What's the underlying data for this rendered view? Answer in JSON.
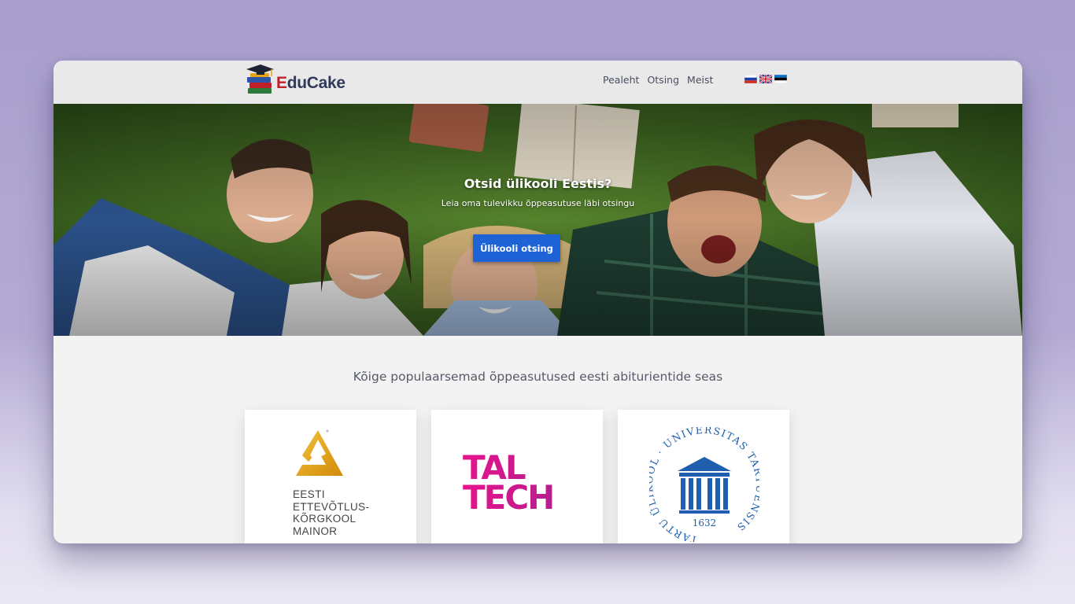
{
  "brand": {
    "name_initial": "E",
    "name_rest": "duCake"
  },
  "nav": {
    "items": [
      {
        "label": "Pealeht"
      },
      {
        "label": "Otsing"
      },
      {
        "label": "Meist"
      }
    ],
    "languages": [
      "ru",
      "en",
      "et"
    ]
  },
  "hero": {
    "title": "Otsid ülikooli Eestis?",
    "subtitle": "Leia oma tulevikku õppeasutuse läbi otsingu",
    "button_label": "Ülikooli otsing"
  },
  "popular": {
    "title": "Kõige populaarsemad õppeasutused eesti abiturientide seas",
    "institutions": [
      {
        "lines": [
          "EESTI",
          "ETTEVÕTLUS-",
          "KÕRGKOOL",
          "MAINOR"
        ]
      },
      {
        "lines": [
          "TAL",
          "TECH"
        ]
      },
      {
        "ring_text": "TARTU ÜLIKOOL · UNIVERSITAS TARTUENSIS",
        "year": "1632"
      }
    ]
  },
  "colors": {
    "accent_button": "#1e63d6",
    "taltech_magenta": "#e8128c",
    "tartu_blue": "#1f5fae",
    "mainor_gold": "#e3a516"
  }
}
